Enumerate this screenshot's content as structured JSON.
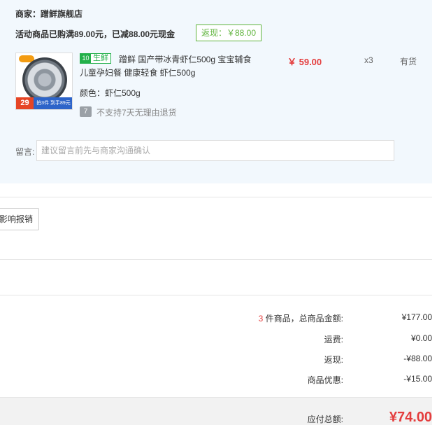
{
  "shop": {
    "name": "商家：蹭鲜旗舰店",
    "promo": "活动商品已购满89.00元，已减88.00元现金",
    "rebate_badge": "返现：￥88.00"
  },
  "product": {
    "thumb_price": "29",
    "thumb_strip": "拍3件 到手89元",
    "fresh_icon": "10",
    "fresh_label": "生鲜",
    "title": "蹭鲜 国产带冰青虾仁500g 宝宝辅食儿童孕妇餐 健康轻食 虾仁500g",
    "spec": "颜色：虾仁500g",
    "return_icon": "7",
    "return_text": "不支持7天无理由退货",
    "unit_price": "￥ 59.00",
    "quantity": "x3",
    "stock": "有货"
  },
  "remark": {
    "label": "留言:",
    "placeholder": "建议留言前先与商家沟通确认",
    "value": ""
  },
  "reimburse_button": "影响报销",
  "summary": {
    "goods_count": "3",
    "goods_label": " 件商品，总商品金额:",
    "goods_amount": "¥177.00",
    "shipping_label": "运费:",
    "shipping_amount": "¥0.00",
    "cashback_label": "返现:",
    "cashback_amount": "-¥88.00",
    "discount_label": "商品优惠:",
    "discount_amount": "-¥15.00",
    "total_label": "应付总额:",
    "total_amount": "¥74.00"
  },
  "colors": {
    "accent_red": "#e43d3d",
    "fresh_green": "#22b04a",
    "panel_bg": "#f2f8fd"
  }
}
